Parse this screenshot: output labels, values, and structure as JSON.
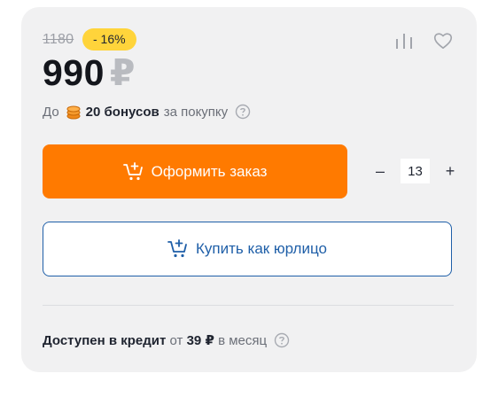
{
  "product": {
    "old_price": "1180",
    "discount": "- 16%",
    "price": "990",
    "currency": "₽"
  },
  "bonus": {
    "prefix": "До",
    "amount": "20 бонусов",
    "suffix": "за покупку"
  },
  "actions": {
    "order_label": "Оформить заказ",
    "legal_label": "Купить как юрлицо",
    "quantity": "13",
    "minus": "–",
    "plus": "+"
  },
  "credit": {
    "label": "Доступен в кредит",
    "from": "от",
    "amount": "39 ₽",
    "period": "в месяц"
  },
  "colors": {
    "accent": "#ff7a00",
    "link": "#1f5fa8",
    "badge": "#ffd43b"
  },
  "icons": [
    "stats-icon",
    "heart-icon",
    "coins-icon",
    "help-icon",
    "cart-plus-icon"
  ]
}
